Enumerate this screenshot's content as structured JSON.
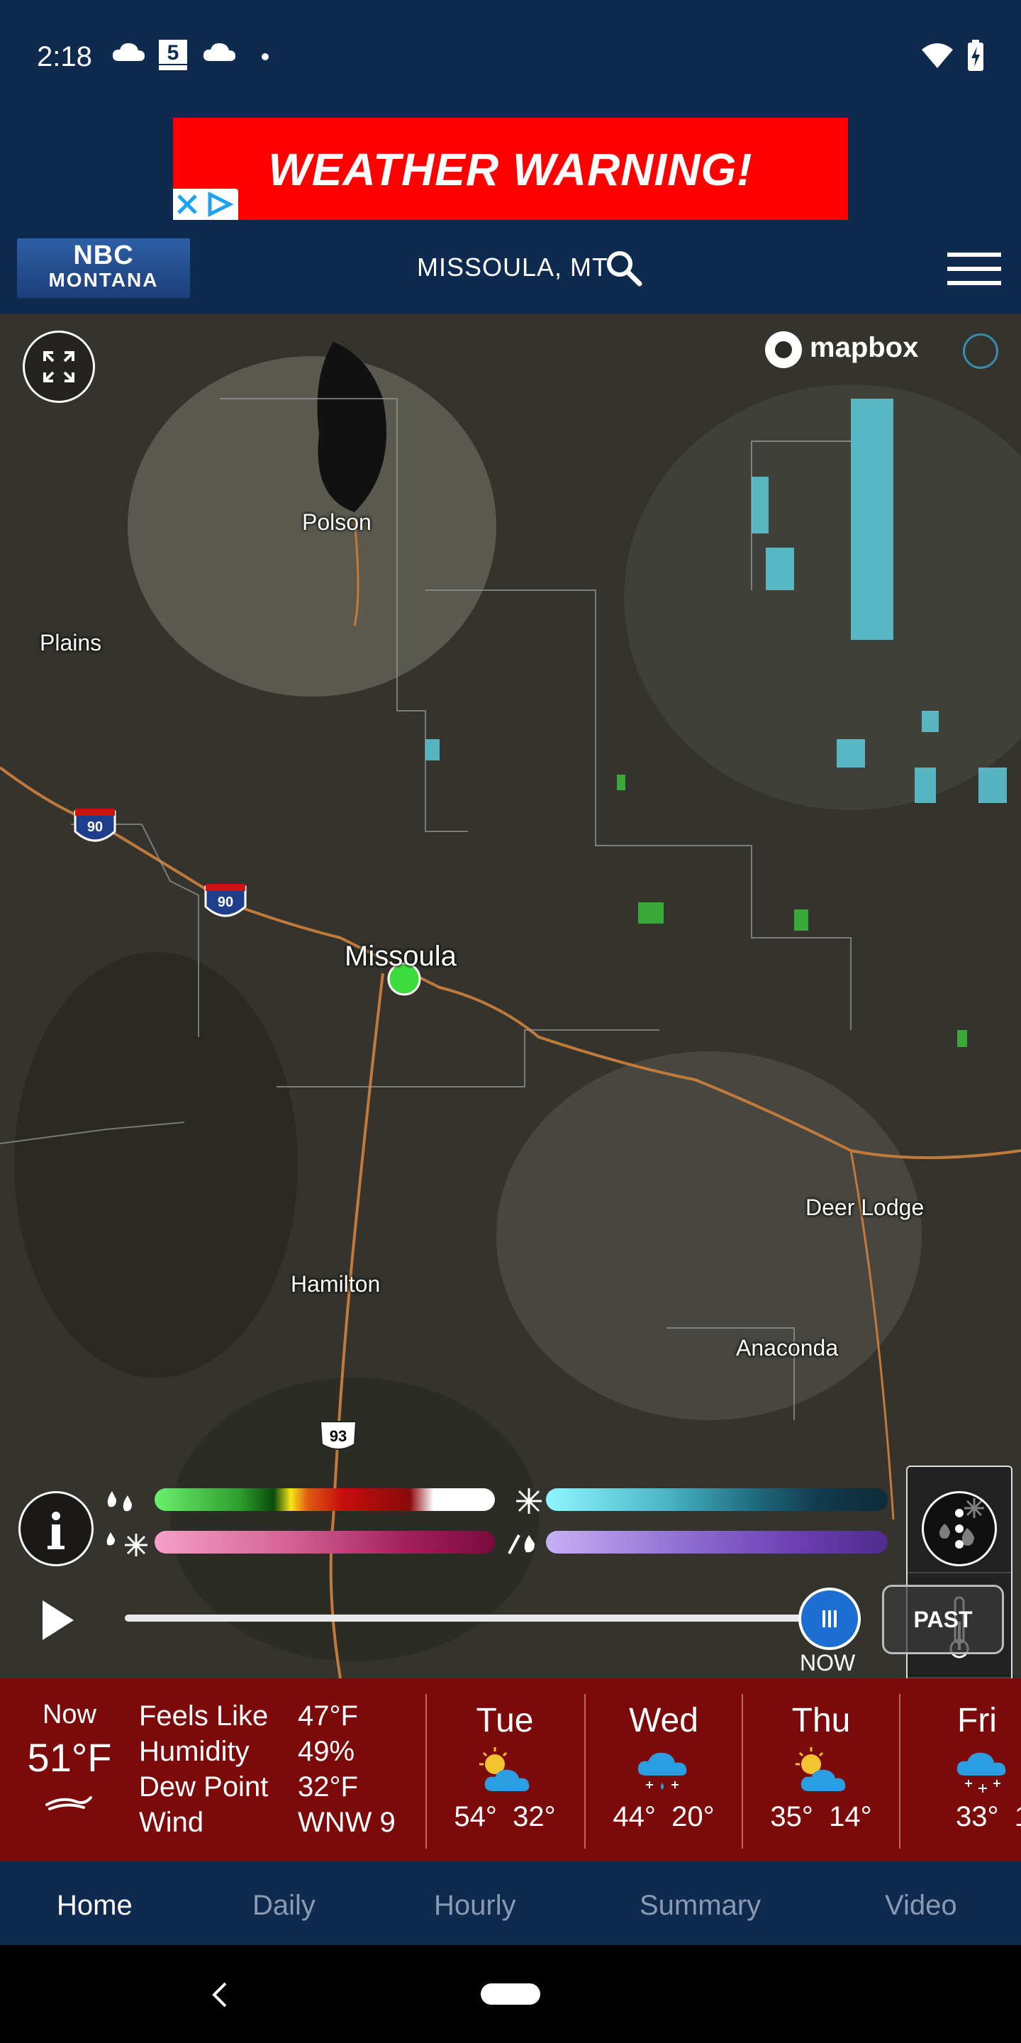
{
  "status_bar": {
    "time": "2:18"
  },
  "ad": {
    "text": "WEATHER WARNING!"
  },
  "header": {
    "logo_line1": "NBC",
    "logo_line2": "MONTANA",
    "location": "MISSOULA, MT"
  },
  "map": {
    "attribution": "mapbox",
    "cities": [
      "Polson",
      "Plains",
      "Missoula",
      "Deer Lodge",
      "Hamilton",
      "Anaconda"
    ],
    "shields": [
      "90",
      "90",
      "93"
    ],
    "layers": [
      "precipitation-icon",
      "thermometer-icon",
      "cloud-icon"
    ]
  },
  "timeline": {
    "now_label": "NOW",
    "past_label": "PAST"
  },
  "current": {
    "now_label": "Now",
    "temp": "51°F",
    "rows": [
      {
        "label": "Feels Like",
        "value": "47°F"
      },
      {
        "label": "Humidity",
        "value": "49%"
      },
      {
        "label": "Dew Point",
        "value": "32°F"
      },
      {
        "label": "Wind",
        "value": "WNW 9"
      }
    ]
  },
  "days": [
    {
      "name": "Tue",
      "hi": "54°",
      "lo": "32°",
      "icon": "partly-cloudy-icon"
    },
    {
      "name": "Wed",
      "hi": "44°",
      "lo": "20°",
      "icon": "rain-snow-icon"
    },
    {
      "name": "Thu",
      "hi": "35°",
      "lo": "14°",
      "icon": "partly-cloudy-icon"
    },
    {
      "name": "Fri",
      "hi": "33°",
      "lo": "1",
      "icon": "snow-icon"
    }
  ],
  "tabs": [
    "Home",
    "Daily",
    "Hourly",
    "Summary",
    "Video"
  ],
  "colors": {
    "brand_navy": "#0f2a4f",
    "forecast_red": "#7d0a0a",
    "ad_red": "#ff0000"
  }
}
